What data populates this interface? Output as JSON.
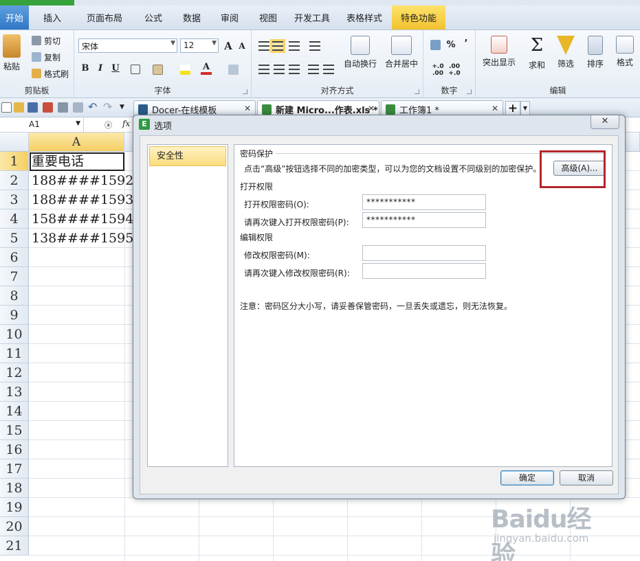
{
  "ribbon_tabs": [
    "开始",
    "插入",
    "页面布局",
    "公式",
    "数据",
    "审阅",
    "视图",
    "开发工具",
    "表格样式",
    "特色功能"
  ],
  "clipboard": {
    "paste": "粘贴",
    "cut": "剪切",
    "copy": "复制",
    "format_painter": "格式刷",
    "group": "剪贴板"
  },
  "font": {
    "name": "宋体",
    "size": "12",
    "group": "字体",
    "bold": "B",
    "italic": "I",
    "underline": "U",
    "grow": "A",
    "shrink": "A"
  },
  "alignment": {
    "wrap": "自动换行",
    "merge": "合并居中",
    "group": "对齐方式"
  },
  "number": {
    "percent": "%",
    "comma": "’",
    "inc_dec": "+.0 .00",
    "dec_dec": ".00 +.0",
    "group": "数字"
  },
  "editing": {
    "highlight": "突出显示",
    "sum": "求和",
    "filter": "筛选",
    "sort": "排序",
    "format": "格式",
    "group": "编辑"
  },
  "doc_tabs": [
    {
      "label": "Docer-在线模板",
      "color": "#2a5c8a"
    },
    {
      "label": "新建 Micro...作表.xls *",
      "color": "#3a8c3f"
    },
    {
      "label": "工作簿1 *",
      "color": "#3a8c3f"
    }
  ],
  "formula_bar": {
    "cell_ref": "A1",
    "fx": "fx"
  },
  "sheet": {
    "column": "A",
    "rows": [
      "1",
      "2",
      "3",
      "4",
      "5",
      "6",
      "7",
      "8",
      "9",
      "10",
      "11",
      "12",
      "13",
      "14",
      "15",
      "16",
      "17",
      "18",
      "19",
      "20",
      "21"
    ],
    "cells": [
      "重要电话",
      "188####1592",
      "188####1593",
      "158####1594",
      "138####1595"
    ]
  },
  "dialog": {
    "title": "选项",
    "close": "✕",
    "nav_item": "安全性",
    "password_section": "密码保护",
    "description": "点击“高级”按钮选择不同的加密类型，可以为您的文档设置不同级别的加密保护。",
    "advanced_button": "高级(A)...",
    "open_section": "打开权限",
    "open_password_label": "打开权限密码(O):",
    "open_password_value": "***********",
    "open_confirm_label": "请再次键入打开权限密码(P):",
    "open_confirm_value": "***********",
    "edit_section": "编辑权限",
    "edit_password_label": "修改权限密码(M):",
    "edit_password_value": "",
    "edit_confirm_label": "请再次键入修改权限密码(R):",
    "edit_confirm_value": "",
    "note": "注意：密码区分大小写，请妥善保管密码，一旦丢失或遗忘，则无法恢复。",
    "ok": "确定",
    "cancel": "取消"
  },
  "watermark": {
    "line1": "Baidu经验",
    "line2": "jingyan.baidu.com"
  },
  "colors": {
    "accent": "#2f76c6",
    "highlight_box": "#b2262a",
    "selection": "#f5cf64"
  }
}
